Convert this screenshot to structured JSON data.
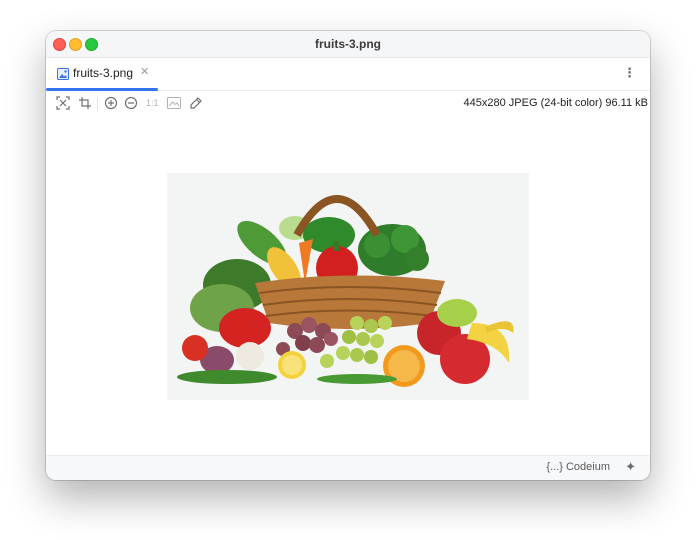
{
  "window": {
    "title": "fruits-3.png"
  },
  "tabs": [
    {
      "label": "fruits-3.png",
      "close_icon": "close-icon",
      "icon": "image-file-icon"
    }
  ],
  "toolbar": {
    "icons": [
      "fit-to-window-icon",
      "crop-icon",
      "zoom-in-icon",
      "zoom-out-icon",
      "actual-size-icon",
      "background-icon",
      "color-picker-icon"
    ],
    "actual_size_label": "1:1"
  },
  "image": {
    "info": "445x280 JPEG (24-bit color) 96.11 kB",
    "content": "fruit-and-vegetable-basket"
  },
  "status_bar": {
    "plugin_label": "{...} Codeium",
    "assistant_icon": "sparkle-icon"
  },
  "colors": {
    "accent": "#3574f0",
    "close": "#fe5f57",
    "minimize": "#febc2e",
    "maximize": "#28c840"
  }
}
